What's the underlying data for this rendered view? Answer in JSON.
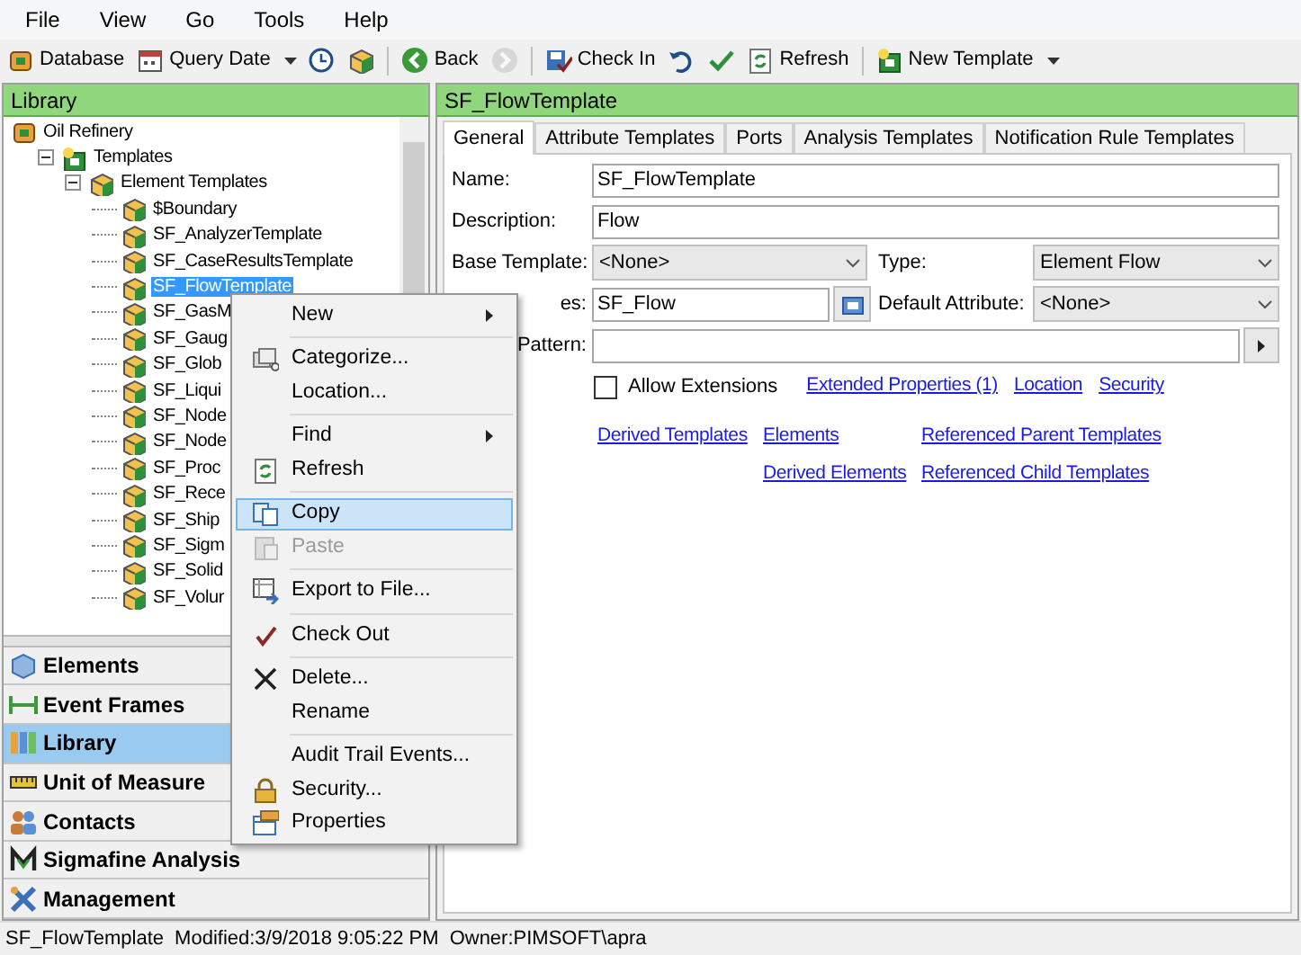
{
  "menu_bar": [
    "File",
    "View",
    "Go",
    "Tools",
    "Help"
  ],
  "toolbar": [
    {
      "kind": "button",
      "label": "Database"
    },
    {
      "kind": "button",
      "label": "Query Date",
      "dropdown": true
    },
    {
      "kind": "icon"
    },
    {
      "kind": "icon"
    },
    {
      "kind": "separator"
    },
    {
      "kind": "button",
      "label": "Back"
    },
    {
      "kind": "icon",
      "disabled": true
    },
    {
      "kind": "separator"
    },
    {
      "kind": "button",
      "label": "Check In"
    },
    {
      "kind": "icon"
    },
    {
      "kind": "icon"
    },
    {
      "kind": "button",
      "label": "Refresh"
    },
    {
      "kind": "separator"
    },
    {
      "kind": "button",
      "label": "New Template",
      "dropdown": true
    }
  ],
  "library": {
    "title": "Library",
    "tree": [
      {
        "label": "Oil Refinery",
        "selected": false,
        "children": [
          {
            "label": "Templates",
            "expanded": true,
            "selected": false,
            "children": [
              {
                "label": "Element Templates",
                "expanded": true,
                "selected": false,
                "children": [
                  {
                    "label": "$Boundary",
                    "selected": false
                  },
                  {
                    "label": "SF_AnalyzerTemplate",
                    "selected": false
                  },
                  {
                    "label": "SF_CaseResultsTemplate",
                    "selected": false
                  },
                  {
                    "label": "SF_FlowTemplate",
                    "selected": true
                  },
                  {
                    "label": "SF_GasM",
                    "selected": false
                  },
                  {
                    "label": "SF_Gaug",
                    "selected": false
                  },
                  {
                    "label": "SF_Glob",
                    "selected": false
                  },
                  {
                    "label": "SF_Liqui",
                    "selected": false
                  },
                  {
                    "label": "SF_Node",
                    "selected": false
                  },
                  {
                    "label": "SF_Node",
                    "selected": false
                  },
                  {
                    "label": "SF_Proc",
                    "selected": false
                  },
                  {
                    "label": "SF_Rece",
                    "selected": false
                  },
                  {
                    "label": "SF_Ship",
                    "selected": false
                  },
                  {
                    "label": "SF_Sigm",
                    "selected": false
                  },
                  {
                    "label": "SF_Solid",
                    "selected": false
                  },
                  {
                    "label": "SF_Volur",
                    "selected": false
                  }
                ]
              }
            ]
          }
        ]
      }
    ]
  },
  "navigation": [
    {
      "label": "Elements",
      "selected": false
    },
    {
      "label": "Event Frames",
      "selected": false
    },
    {
      "label": "Library",
      "selected": true
    },
    {
      "label": "Unit of Measure",
      "selected": false
    },
    {
      "label": "Contacts",
      "selected": false
    },
    {
      "label": "Sigmafine Analysis",
      "selected": false
    },
    {
      "label": "Management",
      "selected": false
    }
  ],
  "detail": {
    "title": "SF_FlowTemplate",
    "tabs": [
      {
        "label": "General",
        "selected": true
      },
      {
        "label": "Attribute Templates",
        "selected": false
      },
      {
        "label": "Ports",
        "selected": false
      },
      {
        "label": "Analysis Templates",
        "selected": false
      },
      {
        "label": "Notification Rule Templates",
        "selected": false
      }
    ],
    "name": {
      "label": "Name:",
      "value": "SF_FlowTemplate"
    },
    "description": {
      "label": "Description:",
      "value": "Flow"
    },
    "base_template": {
      "label": "Base Template:",
      "value": "<None>"
    },
    "type": {
      "label": "Type:",
      "value": "Element Flow"
    },
    "categories": {
      "label": "es:",
      "covered": true,
      "value": "SF_Flow"
    },
    "default_attribute": {
      "label": "Default Attribute:",
      "value": "<None>"
    },
    "naming_pattern": {
      "label": "Pattern:",
      "covered": true
    },
    "allow_extensions": {
      "label": "Allow Extensions",
      "checked": false
    },
    "links_row_1": [
      "Extended Properties (1)",
      "Location",
      "Security"
    ],
    "links_row_2": [
      "Derived Templates",
      "Elements",
      "Referenced Parent Templates"
    ],
    "links_row_3": [
      "Derived Elements",
      "Referenced Child Templates"
    ]
  },
  "context_menu": [
    {
      "kind": "item",
      "label": "New",
      "submenu": true,
      "selected": false,
      "disabled": false
    },
    {
      "kind": "separator"
    },
    {
      "kind": "item",
      "label": "Categorize...",
      "submenu": false,
      "selected": false,
      "disabled": false
    },
    {
      "kind": "item",
      "label": "Location...",
      "submenu": false,
      "selected": false,
      "disabled": false
    },
    {
      "kind": "separator"
    },
    {
      "kind": "item",
      "label": "Find",
      "submenu": true,
      "selected": false,
      "disabled": false
    },
    {
      "kind": "item",
      "label": "Refresh",
      "submenu": false,
      "selected": false,
      "disabled": false
    },
    {
      "kind": "separator"
    },
    {
      "kind": "item",
      "label": "Copy",
      "submenu": false,
      "selected": true,
      "disabled": false
    },
    {
      "kind": "item",
      "label": "Paste",
      "submenu": false,
      "selected": false,
      "disabled": true
    },
    {
      "kind": "separator"
    },
    {
      "kind": "item",
      "label": "Export to File...",
      "submenu": false,
      "selected": false,
      "disabled": false
    },
    {
      "kind": "separator"
    },
    {
      "kind": "item",
      "label": "Check Out",
      "submenu": false,
      "selected": false,
      "disabled": false
    },
    {
      "kind": "separator"
    },
    {
      "kind": "item",
      "label": "Delete...",
      "submenu": false,
      "selected": false,
      "disabled": false
    },
    {
      "kind": "item",
      "label": "Rename",
      "submenu": false,
      "selected": false,
      "disabled": false
    },
    {
      "kind": "separator"
    },
    {
      "kind": "item",
      "label": "Audit Trail Events...",
      "submenu": false,
      "selected": false,
      "disabled": false
    },
    {
      "kind": "item",
      "label": "Security...",
      "submenu": false,
      "selected": false,
      "disabled": false
    },
    {
      "kind": "item",
      "label": "Properties",
      "submenu": false,
      "selected": false,
      "disabled": false
    }
  ],
  "status_bar": [
    "SF_FlowTemplate",
    "Modified:3/9/2018 9:05:22 PM",
    "Owner:PIMSOFT\\apra"
  ]
}
